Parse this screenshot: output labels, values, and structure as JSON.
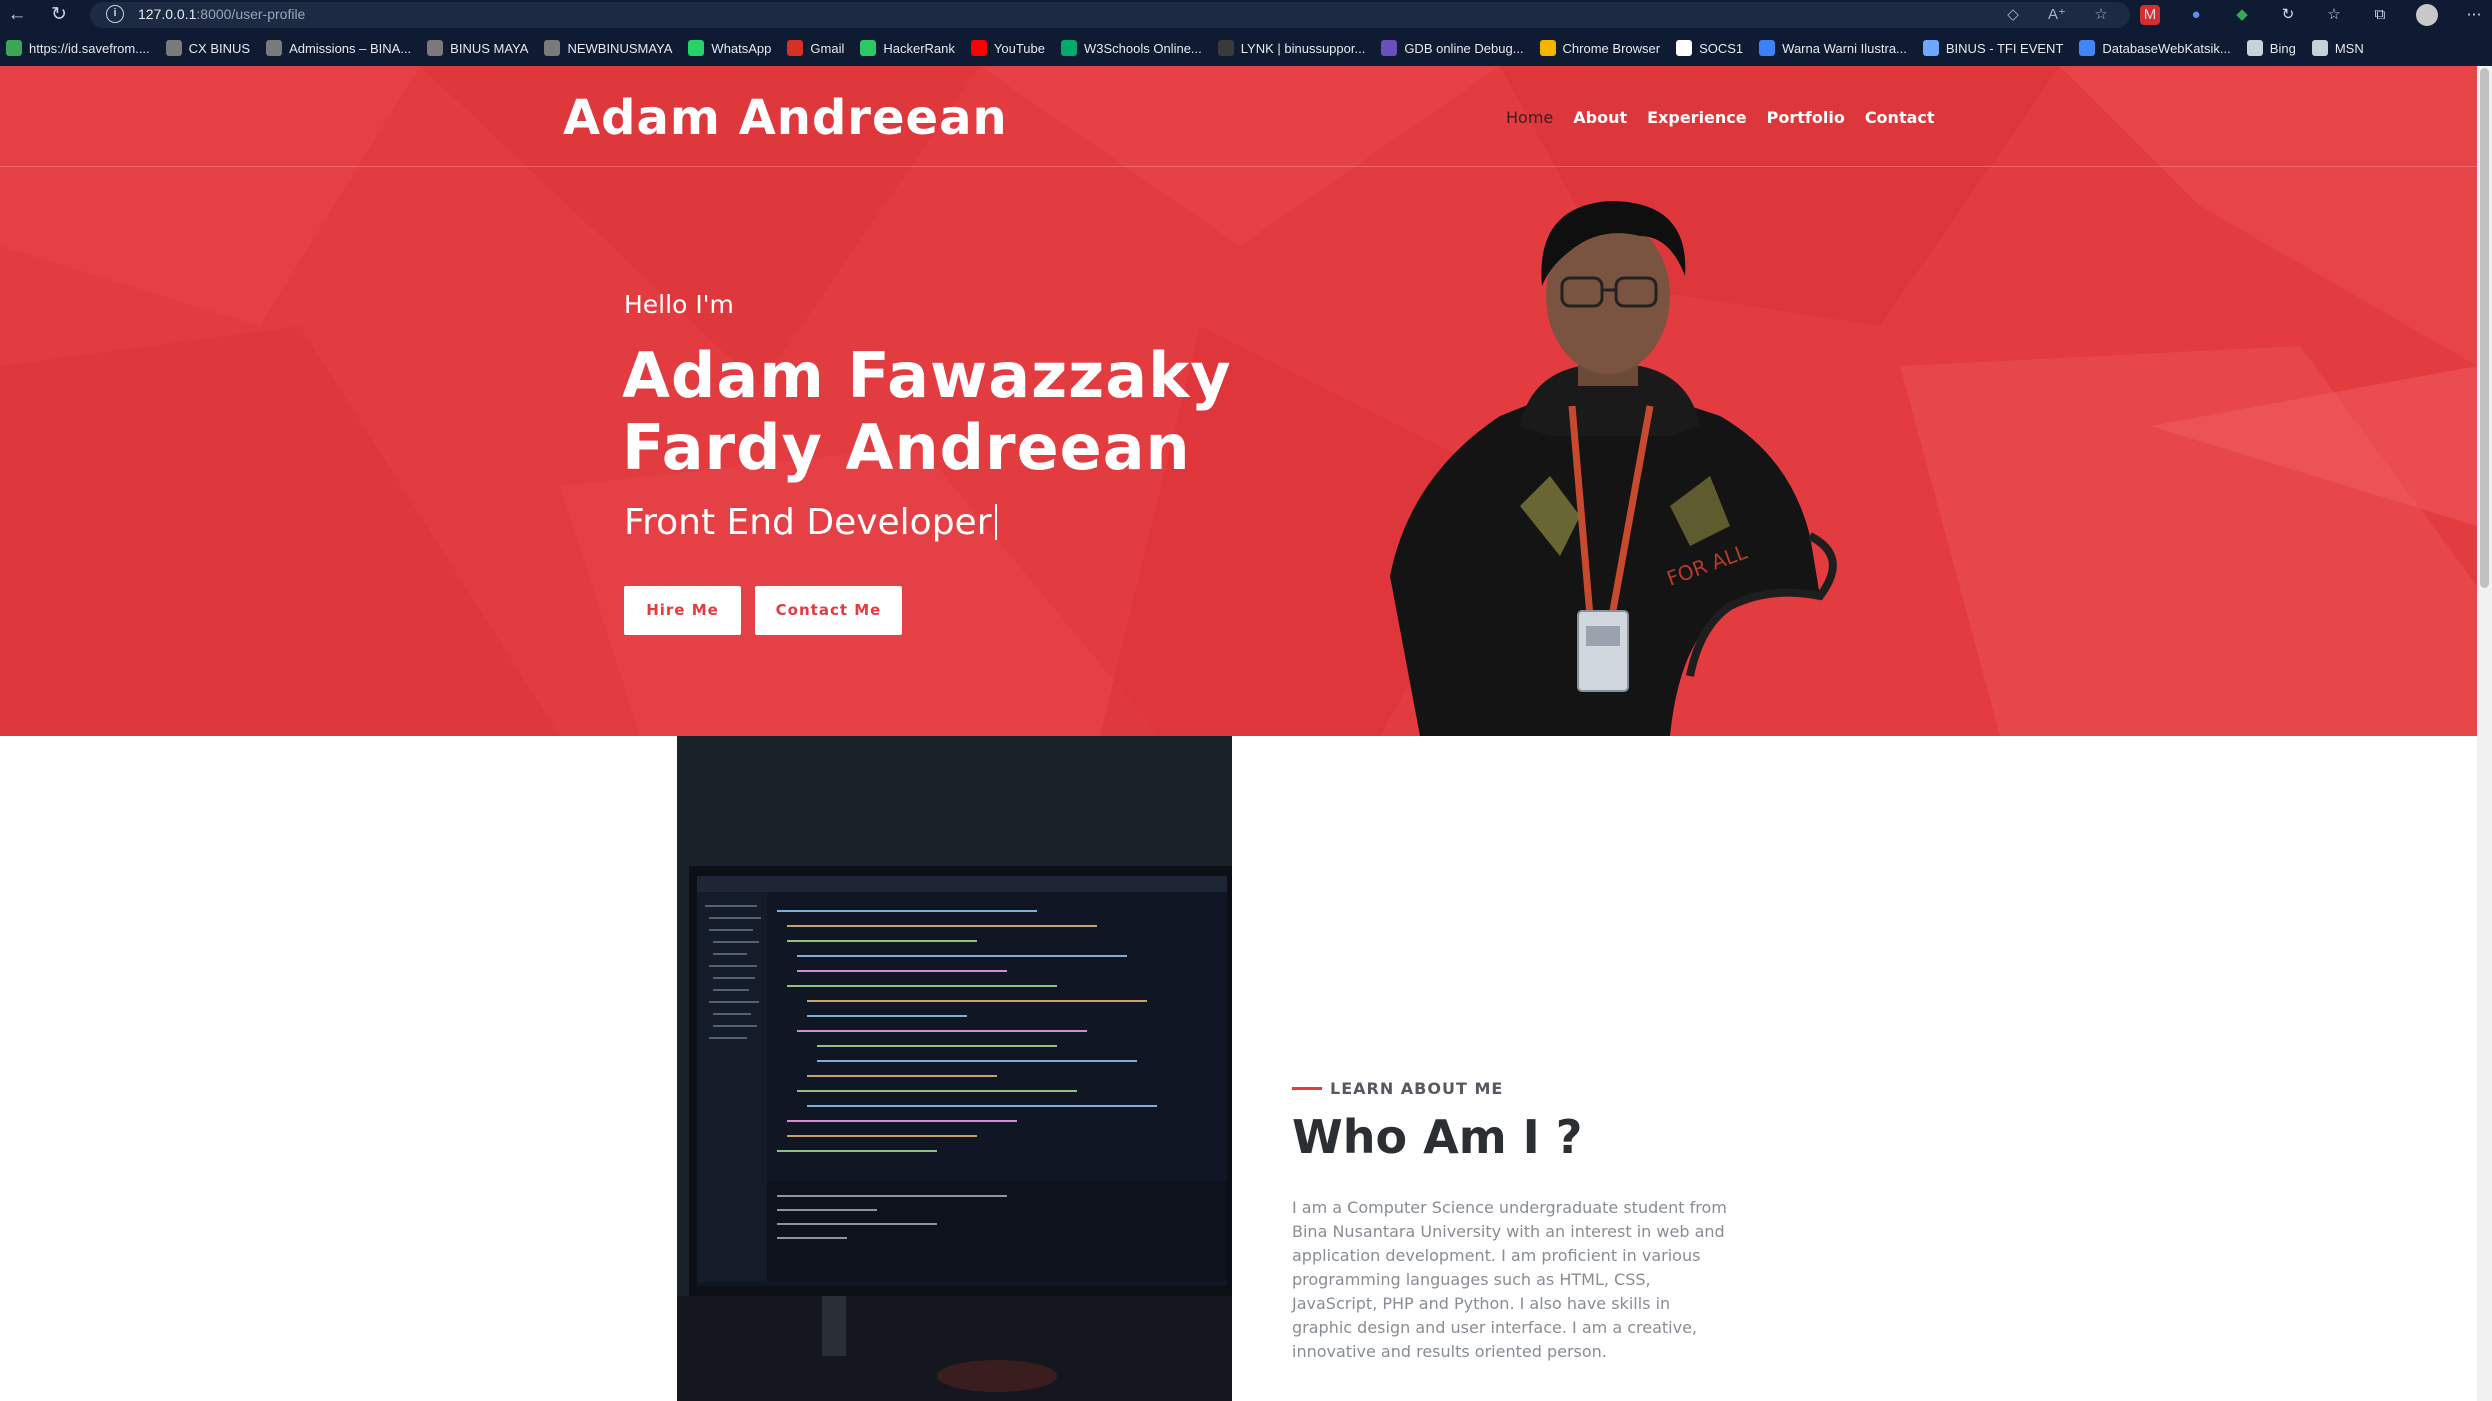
{
  "browser": {
    "url_host": "127.0.0.1",
    "url_rest": ":8000/user-profile",
    "bookmarks": [
      {
        "label": "https://id.savefrom....",
        "icon": "download-icon",
        "color": "#3aa757"
      },
      {
        "label": "CX BINUS",
        "icon": "binus-icon",
        "color": "#7a7a7a"
      },
      {
        "label": "Admissions – BINA...",
        "icon": "binus-icon",
        "color": "#7a7a7a"
      },
      {
        "label": "BINUS MAYA",
        "icon": "binus-icon",
        "color": "#7a7a7a"
      },
      {
        "label": "NEWBINUSMAYA",
        "icon": "binus-icon",
        "color": "#7a7a7a"
      },
      {
        "label": "WhatsApp",
        "icon": "whatsapp-icon",
        "color": "#25d366"
      },
      {
        "label": "Gmail",
        "icon": "gmail-icon",
        "color": "#d93025"
      },
      {
        "label": "HackerRank",
        "icon": "hackerrank-icon",
        "color": "#2ec866"
      },
      {
        "label": "YouTube",
        "icon": "youtube-icon",
        "color": "#ff0000"
      },
      {
        "label": "W3Schools Online...",
        "icon": "w3schools-icon",
        "color": "#04aa6d"
      },
      {
        "label": "LYNK | binussuppor...",
        "icon": "lynk-icon",
        "color": "#3a3a3a"
      },
      {
        "label": "GDB online Debug...",
        "icon": "gdb-icon",
        "color": "#6b4fbb"
      },
      {
        "label": "Chrome Browser",
        "icon": "chrome-icon",
        "color": "#f4b400"
      },
      {
        "label": "SOCS1",
        "icon": "socs-icon",
        "color": "#ffffff"
      },
      {
        "label": "Warna Warni Ilustra...",
        "icon": "canva-icon",
        "color": "#3b82f6"
      },
      {
        "label": "BINUS - TFI EVENT",
        "icon": "globe-icon",
        "color": "#6ea8fe"
      },
      {
        "label": "DatabaseWebKatsik...",
        "icon": "docs-icon",
        "color": "#4285f4"
      },
      {
        "label": "Bing",
        "icon": "page-icon",
        "color": "#c9d1dc"
      },
      {
        "label": "MSN",
        "icon": "page-icon",
        "color": "#c9d1dc"
      }
    ]
  },
  "site": {
    "brand": "Adam Andreean",
    "nav": [
      "Home",
      "About",
      "Experience",
      "Portfolio",
      "Contact"
    ],
    "active_nav": "Home",
    "accent": "#e23b40"
  },
  "hero": {
    "greeting": "Hello I'm",
    "name_line1": "Adam Fawazzaky",
    "name_line2": "Fardy Andreean",
    "role": "Front End Developer",
    "hire_button": "Hire Me",
    "contact_button": "Contact Me"
  },
  "about": {
    "eyebrow": "LEARN ABOUT ME",
    "title": "Who Am I ?",
    "body": "I am a Computer Science undergraduate student from Bina Nusantara University with an interest in web and application development. I am proficient in various programming languages such as HTML, CSS, JavaScript, PHP and Python. I also have skills in graphic design and user interface. I am a creative, innovative and results oriented person."
  }
}
